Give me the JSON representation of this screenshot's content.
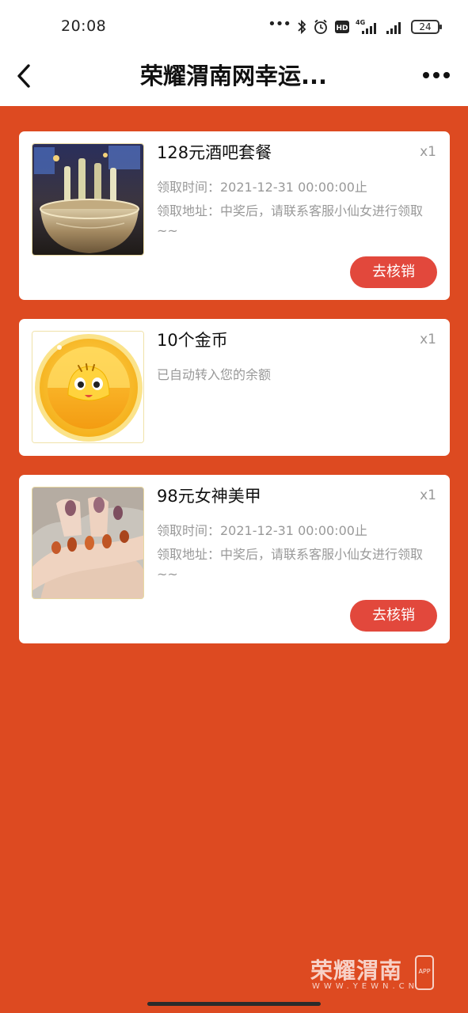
{
  "status_bar": {
    "time": "20:08",
    "network": "4G",
    "hd_badge": "HD",
    "battery": "24",
    "icons": [
      "more-dots-icon",
      "bluetooth-icon",
      "alarm-icon",
      "hd-icon",
      "signal-4g-icon",
      "signal-icon",
      "battery-icon"
    ]
  },
  "navbar": {
    "title": "荣耀渭南网幸运...",
    "back_icon": "chevron-left-icon",
    "more_icon": "more-horizontal-icon"
  },
  "prizes": [
    {
      "name": "128元酒吧套餐",
      "qty": "x1",
      "time_line": "领取时间：2021-12-31 00:00:00止",
      "address_line": "领取地址：中奖后，请联系客服小仙女进行领取~~",
      "button": "去核销",
      "image": "bar-wine-bucket-image"
    },
    {
      "name": "10个金币",
      "qty": "x1",
      "note": "已自动转入您的余额",
      "image": "gold-coin-image"
    },
    {
      "name": "98元女神美甲",
      "qty": "x1",
      "time_line": "领取时间：2021-12-31 00:00:00止",
      "address_line": "领取地址：中奖后，请联系客服小仙女进行领取~~",
      "button": "去核销",
      "image": "manicure-nails-image"
    }
  ],
  "watermark": {
    "brand": "荣耀渭南",
    "url": "WWW.YEWN.CN",
    "badge": "APP"
  },
  "colors": {
    "page_background": "#dd4a21",
    "button": "#e2483c",
    "card": "#ffffff",
    "muted_text": "#999999"
  }
}
